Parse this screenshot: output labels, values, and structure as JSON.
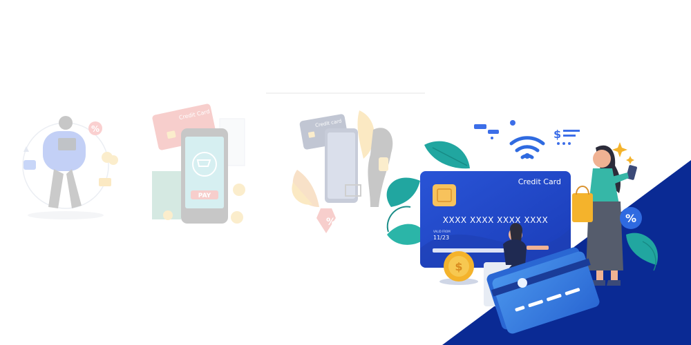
{
  "panels": [
    {
      "label": "online-shopper-illustration"
    },
    {
      "label": "mobile-pay-illustration"
    },
    {
      "label": "card-to-phone-shopping-illustration"
    },
    {
      "label": "credit-card-shopping-illustration"
    }
  ],
  "phone_pay_label": "PAY",
  "faded_card_label": "Credit Card",
  "faded_card2_label": "Credit card",
  "hero_card": {
    "title": "Credit Card",
    "number": "XXXX XXXX XXXX XXXX",
    "valid_label": "VALID FROM",
    "expiry": "11/23"
  },
  "percent_symbol": "%",
  "dollar_symbol": "$",
  "colors": {
    "navy": "#0a2a94",
    "card_blue": "#1f46c8",
    "card_light": "#3a7fe0",
    "teal_leaf": "#21a6a0",
    "gold": "#f4b32c"
  }
}
